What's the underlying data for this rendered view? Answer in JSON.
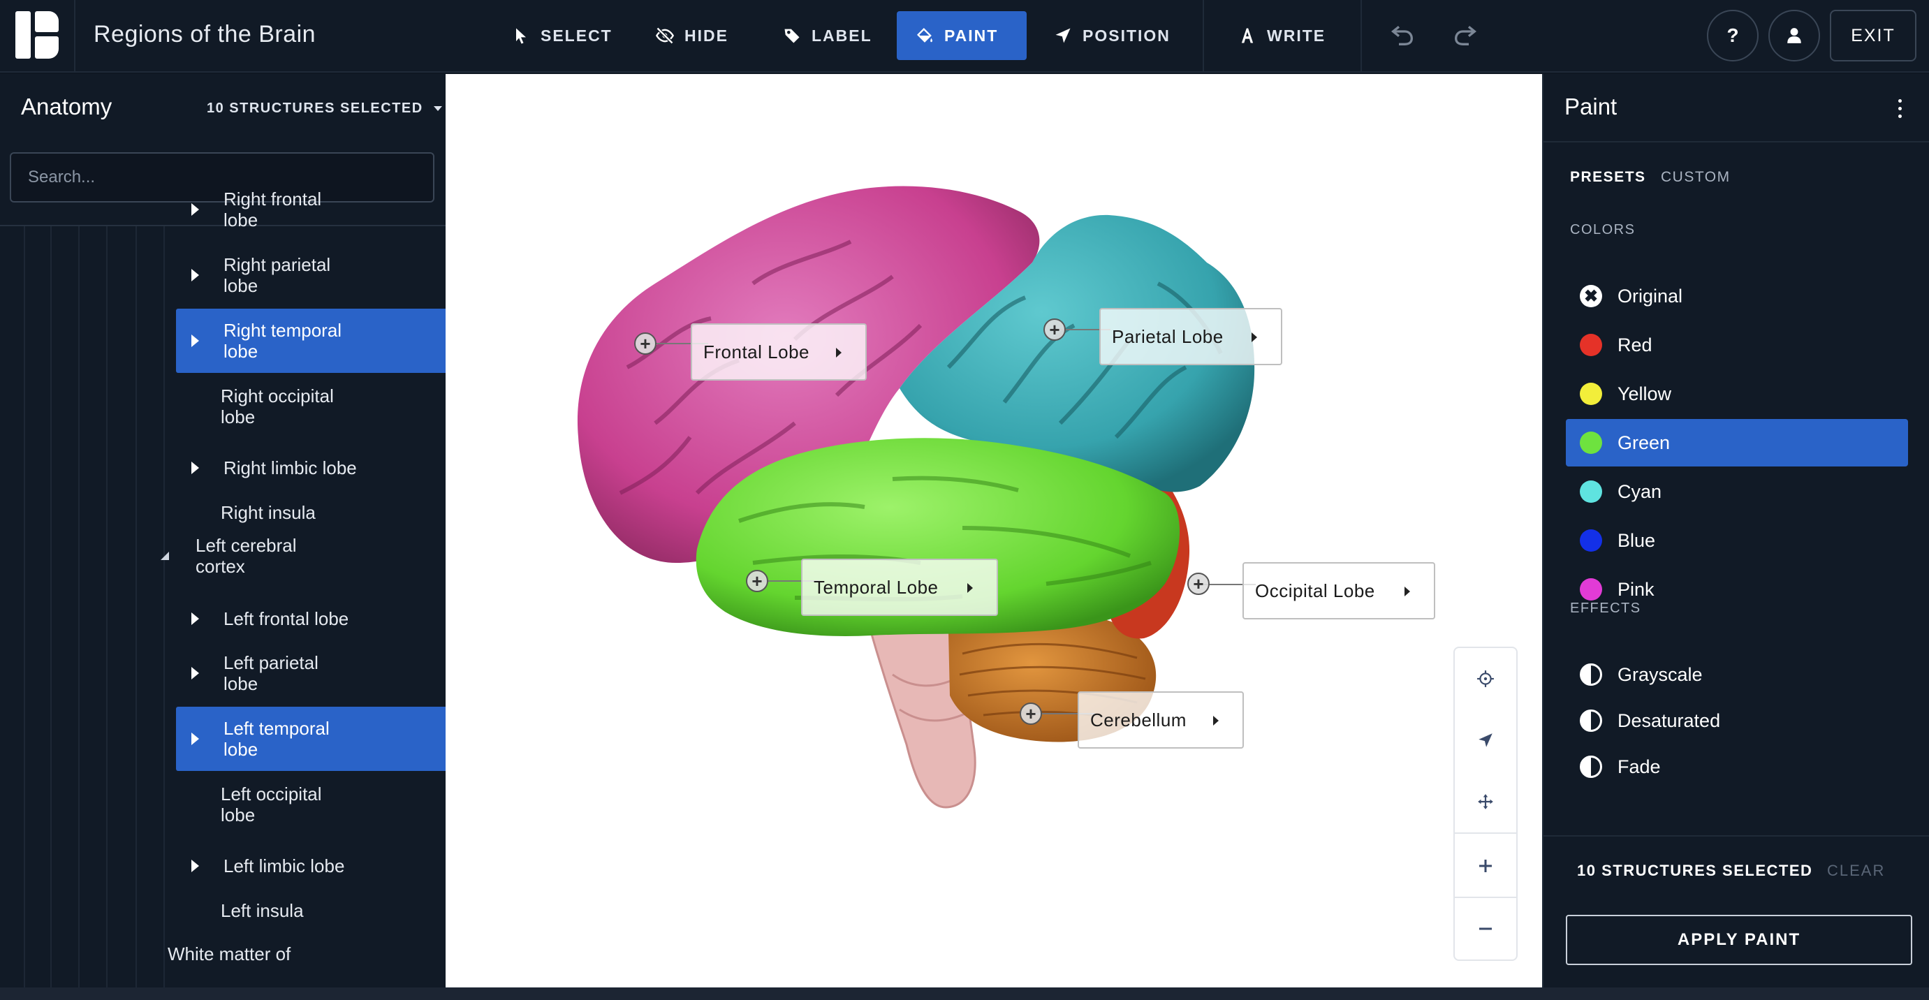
{
  "app": {
    "title": "Regions of the Brain"
  },
  "toolbar": {
    "tools": [
      {
        "label": "SELECT",
        "icon": "cursor-icon"
      },
      {
        "label": "HIDE",
        "icon": "eye-off-icon"
      },
      {
        "label": "LABEL",
        "icon": "tag-icon"
      },
      {
        "label": "PAINT",
        "icon": "paint-bucket-icon",
        "active": true
      },
      {
        "label": "POSITION",
        "icon": "navigation-arrow-icon"
      },
      {
        "label": "WRITE",
        "icon": "text-a-icon"
      }
    ],
    "help": "?",
    "exit": "EXIT"
  },
  "anatomy": {
    "title": "Anatomy",
    "selected": "10 STRUCTURES SELECTED",
    "search_placeholder": "Search...",
    "items": [
      {
        "label": "Right frontal\nlobe",
        "expandable": true,
        "selected": false
      },
      {
        "label": "Right parietal\nlobe",
        "expandable": true,
        "selected": false
      },
      {
        "label": "Right temporal\nlobe",
        "expandable": true,
        "selected": true
      },
      {
        "label": "Right occipital\nlobe",
        "expandable": false,
        "selected": false
      },
      {
        "label": "Right limbic lobe",
        "expandable": true,
        "selected": false
      },
      {
        "label": "Right insula",
        "expandable": false,
        "selected": false
      },
      {
        "label": "Left cerebral\ncortex",
        "expandable": true,
        "expanded": true,
        "selected": false
      },
      {
        "label": "Left frontal lobe",
        "expandable": true,
        "selected": false
      },
      {
        "label": "Left parietal\nlobe",
        "expandable": true,
        "selected": false
      },
      {
        "label": "Left temporal\nlobe",
        "expandable": true,
        "selected": true
      },
      {
        "label": "Left occipital\nlobe",
        "expandable": false,
        "selected": false
      },
      {
        "label": "Left limbic lobe",
        "expandable": true,
        "selected": false
      },
      {
        "label": "Left insula",
        "expandable": false,
        "selected": false
      },
      {
        "label": "White matter of",
        "expandable": false,
        "selected": false
      }
    ]
  },
  "viewer": {
    "labels": [
      {
        "text": "Frontal Lobe"
      },
      {
        "text": "Parietal Lobe"
      },
      {
        "text": "Temporal Lobe"
      },
      {
        "text": "Occipital Lobe"
      },
      {
        "text": "Cerebellum"
      }
    ],
    "region_colors": {
      "frontal": "#d1489a",
      "parietal": "#3aa9b2",
      "temporal": "#6fe13a",
      "occipital": "#c8381f",
      "cerebellum": "#c2702a",
      "brainstem": "#e6b3b3"
    }
  },
  "paint": {
    "title": "Paint",
    "tabs": [
      "PRESETS",
      "CUSTOM"
    ],
    "colors_heading": "COLORS",
    "colors": [
      {
        "label": "Original",
        "color": "#ffffff"
      },
      {
        "label": "Red",
        "color": "#e53228"
      },
      {
        "label": "Yellow",
        "color": "#f2ee3a"
      },
      {
        "label": "Green",
        "color": "#6ee23f",
        "selected": true
      },
      {
        "label": "Cyan",
        "color": "#5fe3e0"
      },
      {
        "label": "Blue",
        "color": "#1330e8"
      },
      {
        "label": "Pink",
        "color": "#e23bd6"
      }
    ],
    "effects_heading": "EFFECTS",
    "effects": [
      {
        "label": "Grayscale"
      },
      {
        "label": "Desaturated"
      },
      {
        "label": "Fade"
      }
    ],
    "selected_count": "10 STRUCTURES SELECTED",
    "clear": "CLEAR",
    "apply": "APPLY PAINT"
  }
}
